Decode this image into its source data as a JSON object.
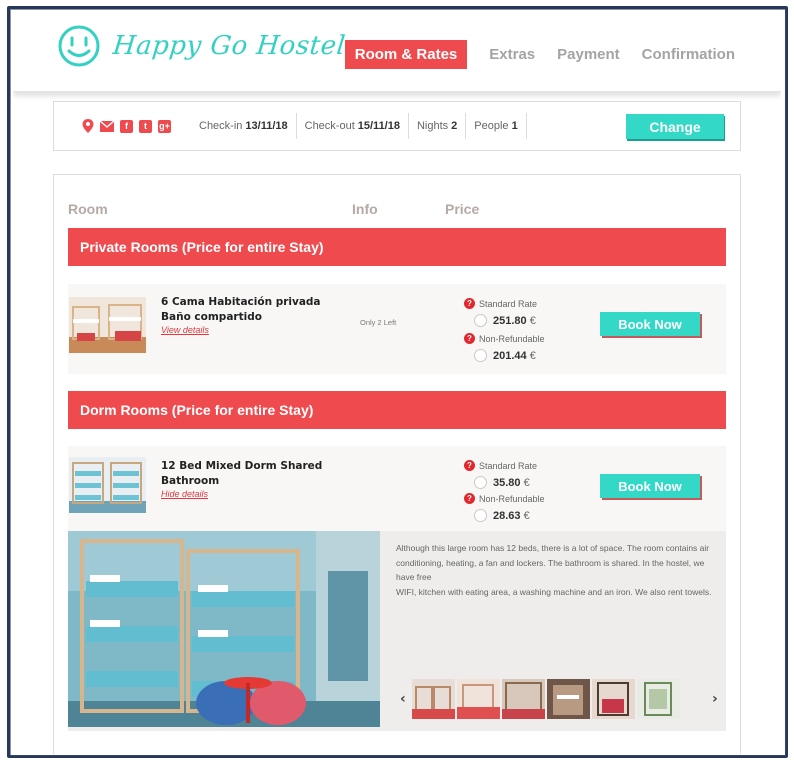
{
  "brand": {
    "name": "Happy Go Hostel",
    "color": "#33d1c1"
  },
  "nav": {
    "items": [
      {
        "label": "Room & Rates",
        "active": true
      },
      {
        "label": "Extras",
        "active": false
      },
      {
        "label": "Payment",
        "active": false
      },
      {
        "label": "Confirmation",
        "active": false
      }
    ]
  },
  "social_icons": [
    "map-pin-icon",
    "email-icon",
    "facebook-icon",
    "twitter-icon",
    "google-plus-icon"
  ],
  "booking": {
    "checkin_label": "Check-in",
    "checkin_value": "13/11/18",
    "checkout_label": "Check-out",
    "checkout_value": "15/11/18",
    "nights_label": "Nights",
    "nights_value": "2",
    "people_label": "People",
    "people_value": "1",
    "change_label": "Change"
  },
  "table": {
    "col_room": "Room",
    "col_info": "Info",
    "col_price": "Price"
  },
  "sections": [
    {
      "title": "Private Rooms (Price for entire Stay)",
      "rooms": [
        {
          "name": "6 Cama Habitación privada Baño compartido",
          "link": "View details",
          "note": "Only 2 Left",
          "rate1_label": "Standard Rate",
          "rate1_price": "251.80",
          "rate1_currency": "€",
          "rate2_label": "Non-Refundable",
          "rate2_price": "201.44",
          "rate2_currency": "€",
          "book_label": "Book Now"
        }
      ]
    },
    {
      "title": "Dorm Rooms (Price for entire Stay)",
      "rooms": [
        {
          "name": "12 Bed Mixed Dorm Shared Bathroom",
          "link": "Hide details",
          "note": "",
          "rate1_label": "Standard Rate",
          "rate1_price": "35.80",
          "rate1_currency": "€",
          "rate2_label": "Non-Refundable",
          "rate2_price": "28.63",
          "rate2_currency": "€",
          "book_label": "Book Now"
        }
      ]
    }
  ],
  "detail": {
    "desc_line1": "Although this large room has 12 beds, there is a lot of space. The room contains air conditioning, heating, a fan and lockers. The bathroom is shared. In the hostel, we have free",
    "desc_line2": "WIFI, kitchen with eating area, a washing machine and an iron. We also rent towels.",
    "prev_arrow": "‹",
    "next_arrow": "›"
  },
  "colors": {
    "accent_red": "#ef4b4f",
    "accent_teal": "#33d9c6",
    "frame_navy": "#27385b"
  }
}
